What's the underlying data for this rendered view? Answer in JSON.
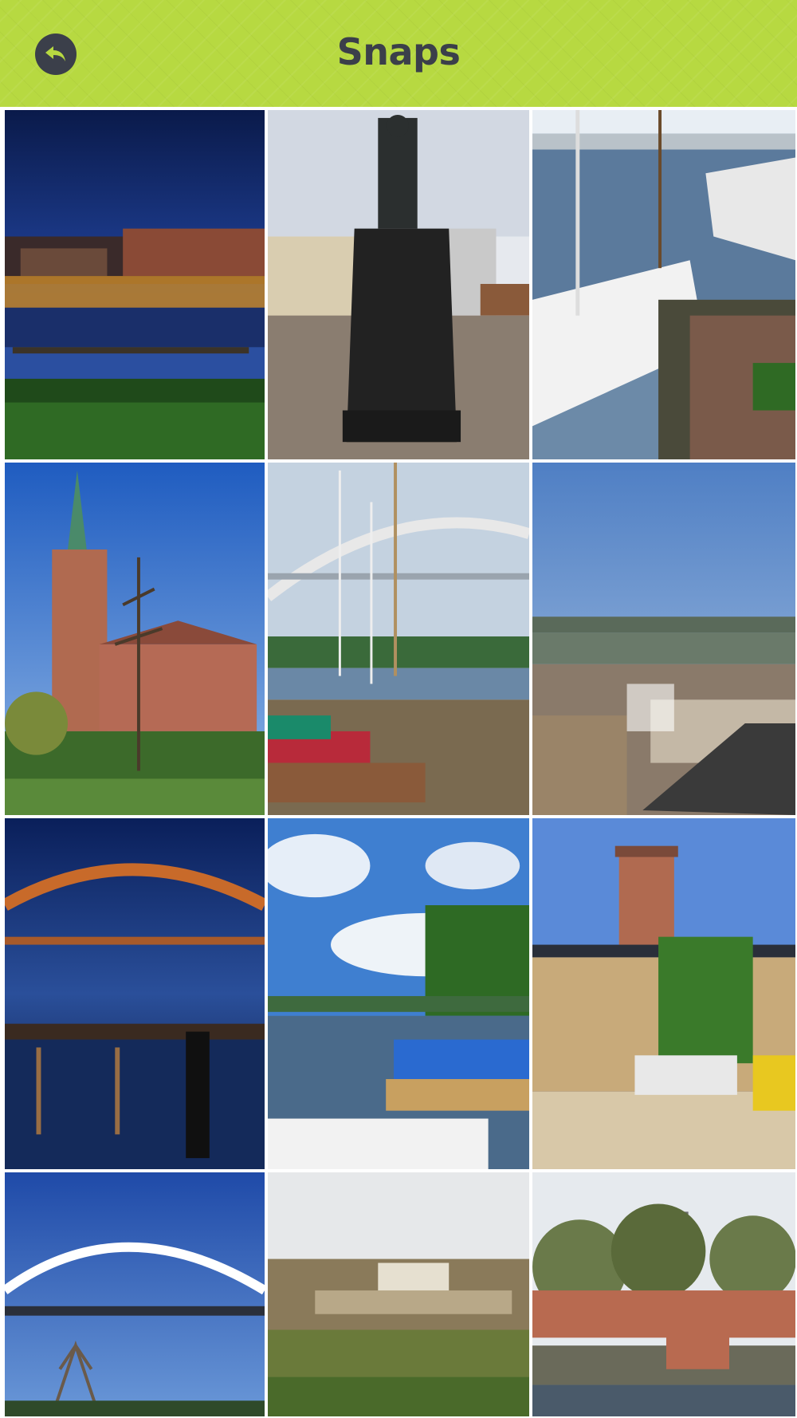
{
  "header": {
    "title": "Snaps",
    "back_icon": "back-arrow-icon",
    "bar_color": "#b7d941",
    "title_color": "#3b3f4a"
  },
  "gallery": {
    "photos": [
      {
        "subject": "harbor-night"
      },
      {
        "subject": "statue-square"
      },
      {
        "subject": "tall-ships-crowd"
      },
      {
        "subject": "brick-church"
      },
      {
        "subject": "sailboats-bridge"
      },
      {
        "subject": "town-rooftops"
      },
      {
        "subject": "bridge-night"
      },
      {
        "subject": "boats-river"
      },
      {
        "subject": "town-hall-tower"
      },
      {
        "subject": "bridge-blue-sky"
      },
      {
        "subject": "fortress-hillside"
      },
      {
        "subject": "old-town-trees"
      }
    ]
  }
}
